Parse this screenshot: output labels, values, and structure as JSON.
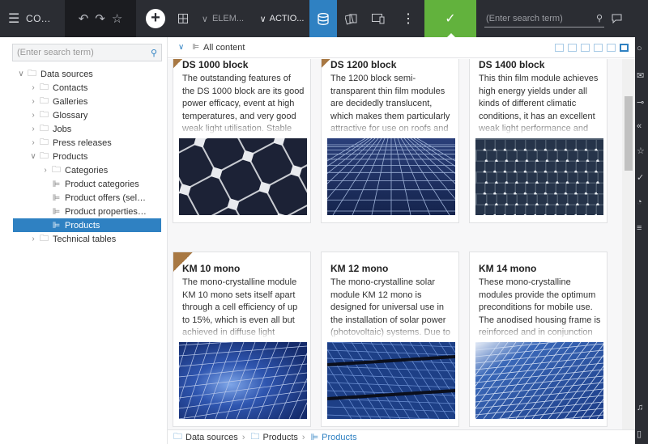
{
  "topbar": {
    "menu_icon": "hamburger-icon",
    "title": "CO...",
    "undo_icon": "undo-icon",
    "redo_icon": "redo-icon",
    "favorite_icon": "star-icon",
    "add_icon": "plus-icon",
    "elements_dropdown": "ELEM...",
    "actions_dropdown": "ACTIO...",
    "search_placeholder": "(Enter search term)"
  },
  "sidebar": {
    "search_placeholder": "(Enter search term)",
    "tree": [
      {
        "label": "Data sources",
        "level": 0,
        "expanded": true,
        "type": "folder"
      },
      {
        "label": "Contacts",
        "level": 1,
        "expanded": false,
        "type": "folder"
      },
      {
        "label": "Galleries",
        "level": 1,
        "expanded": false,
        "type": "folder"
      },
      {
        "label": "Glossary",
        "level": 1,
        "expanded": false,
        "type": "folder"
      },
      {
        "label": "Jobs",
        "level": 1,
        "expanded": false,
        "type": "folder"
      },
      {
        "label": "Press releases",
        "level": 1,
        "expanded": false,
        "type": "folder"
      },
      {
        "label": "Products",
        "level": 1,
        "expanded": true,
        "type": "folder"
      },
      {
        "label": "Categories",
        "level": 2,
        "expanded": false,
        "type": "folder"
      },
      {
        "label": "Product categories",
        "level": 2,
        "type": "list"
      },
      {
        "label": "Product offers (sel…",
        "level": 2,
        "type": "list"
      },
      {
        "label": "Product properties…",
        "level": 2,
        "type": "list"
      },
      {
        "label": "Products",
        "level": 2,
        "type": "list",
        "selected": true
      },
      {
        "label": "Technical tables",
        "level": 1,
        "expanded": false,
        "type": "folder"
      }
    ]
  },
  "main": {
    "header_title": "All content",
    "cards": [
      {
        "title": "DS 1000 block",
        "ribbon": true,
        "description": "The outstanding features of the DS 1000 block are its good power efficacy, event at high temperatures, and very good weak light utilisation. Stable"
      },
      {
        "title": "DS 1200 block",
        "ribbon": true,
        "description": "The 1200 block semi-transparent thin film modules are decidedly translucent, which makes them particularly attractive for use on roofs and facades."
      },
      {
        "title": "DS 1400 block",
        "ribbon": false,
        "description": "This thin film module achieves high energy yields under all kinds of different climatic conditions, it has an excellent weak light performance and"
      },
      {
        "title": "KM 10 mono",
        "ribbon": true,
        "description": "The mono-crystalline module KM 10 mono sets itself apart through a cell efficiency of up to 15%, which is even all but achieved in diffuse light conditions (e.g."
      },
      {
        "title": "KM 12 mono",
        "ribbon": false,
        "description": "The mono-crystalline solar module KM 12 mono is designed for universal use in the installation of solar power (photovoltaic) systems. Due to its"
      },
      {
        "title": "KM 14 mono",
        "ribbon": false,
        "description": "These mono-crystalline modules provide the optimum preconditions for mobile use. The anodised housing frame is reinforced and in conjunction"
      }
    ]
  },
  "breadcrumb": [
    "Data sources",
    "Products",
    "Products"
  ],
  "colors": {
    "accent": "#2f81c2",
    "confirm": "#62b23d",
    "topbar": "#2b2d33",
    "ribbon": "#a87843"
  }
}
